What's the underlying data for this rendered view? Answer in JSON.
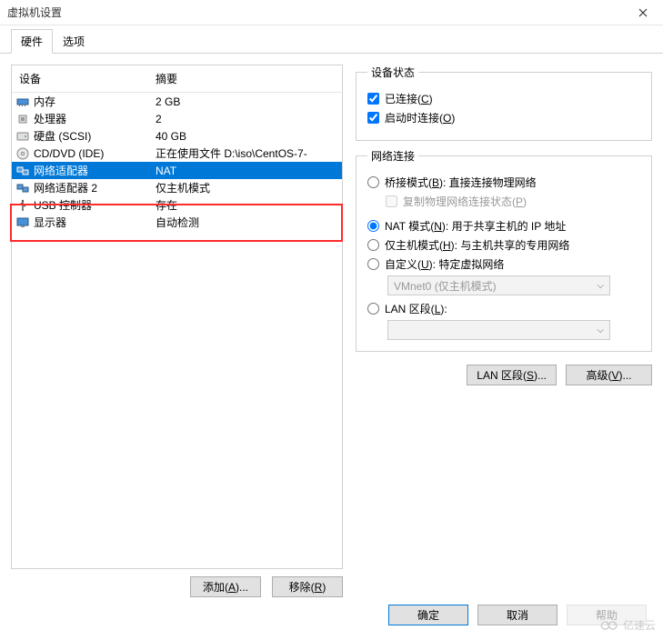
{
  "title": "虚拟机设置",
  "tabs": {
    "hardware": "硬件",
    "options": "选项"
  },
  "listHeaders": {
    "device": "设备",
    "summary": "摘要"
  },
  "devices": [
    {
      "icon": "memory",
      "label": "内存",
      "summary": "2 GB",
      "selected": false
    },
    {
      "icon": "cpu",
      "label": "处理器",
      "summary": "2",
      "selected": false
    },
    {
      "icon": "disk",
      "label": "硬盘 (SCSI)",
      "summary": "40 GB",
      "selected": false
    },
    {
      "icon": "cd",
      "label": "CD/DVD (IDE)",
      "summary": "正在使用文件 D:\\iso\\CentOS-7-",
      "selected": false
    },
    {
      "icon": "net",
      "label": "网络适配器",
      "summary": "NAT",
      "selected": true
    },
    {
      "icon": "net",
      "label": "网络适配器 2",
      "summary": "仅主机模式",
      "selected": false
    },
    {
      "icon": "usb",
      "label": "USB 控制器",
      "summary": "存在",
      "selected": false
    },
    {
      "icon": "display",
      "label": "显示器",
      "summary": "自动检测",
      "selected": false
    }
  ],
  "leftButtons": {
    "add": "添加(A)...",
    "remove": "移除(R)"
  },
  "rightSections": {
    "deviceStatus": {
      "title": "设备状态",
      "connected": "已连接(C)",
      "connectAtPowerOn": "启动时连接(O)"
    },
    "network": {
      "title": "网络连接",
      "bridged": "桥接模式(B): 直接连接物理网络",
      "replicate": "复制物理网络连接状态(P)",
      "nat": "NAT 模式(N): 用于共享主机的 IP 地址",
      "hostOnly": "仅主机模式(H): 与主机共享的专用网络",
      "custom": "自定义(U): 特定虚拟网络",
      "customDropdown": "VMnet0 (仅主机模式)",
      "lanSegment": "LAN 区段(L):",
      "lanSegmentBtn": "LAN 区段(S)...",
      "advancedBtn": "高级(V)..."
    }
  },
  "dialogButtons": {
    "ok": "确定",
    "cancel": "取消",
    "help": "帮助"
  },
  "watermark": "亿速云"
}
